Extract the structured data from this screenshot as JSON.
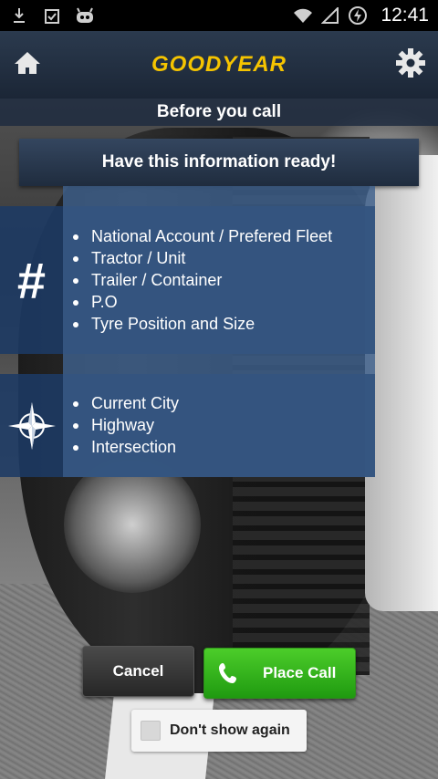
{
  "status_bar": {
    "time": "12:41",
    "left_icons": [
      "download-icon",
      "clipboard-check-icon",
      "android-icon"
    ],
    "right_icons": [
      "wifi-icon",
      "signal-icon",
      "battery-charging-icon"
    ]
  },
  "header": {
    "logo": "GOODYEAR",
    "home_icon": "home-icon",
    "settings_icon": "gear-icon"
  },
  "subtitle": "Before you call",
  "banner": "Have this information ready!",
  "section_account": {
    "icon": "hash-icon",
    "glyph": "#",
    "items": [
      "National Account / Prefered Fleet",
      "Tractor / Unit",
      "Trailer / Container",
      "P.O",
      "Tyre Position and Size"
    ]
  },
  "section_location": {
    "icon": "compass-icon",
    "items": [
      "Current City",
      "Highway",
      "Intersection"
    ]
  },
  "buttons": {
    "cancel": "Cancel",
    "place_call": "Place Call"
  },
  "checkbox": {
    "label": "Don't show again",
    "checked": false
  },
  "colors": {
    "logo_yellow": "#f5c400",
    "place_call_green": "#2fb51a",
    "header_navy": "#1b2636"
  }
}
